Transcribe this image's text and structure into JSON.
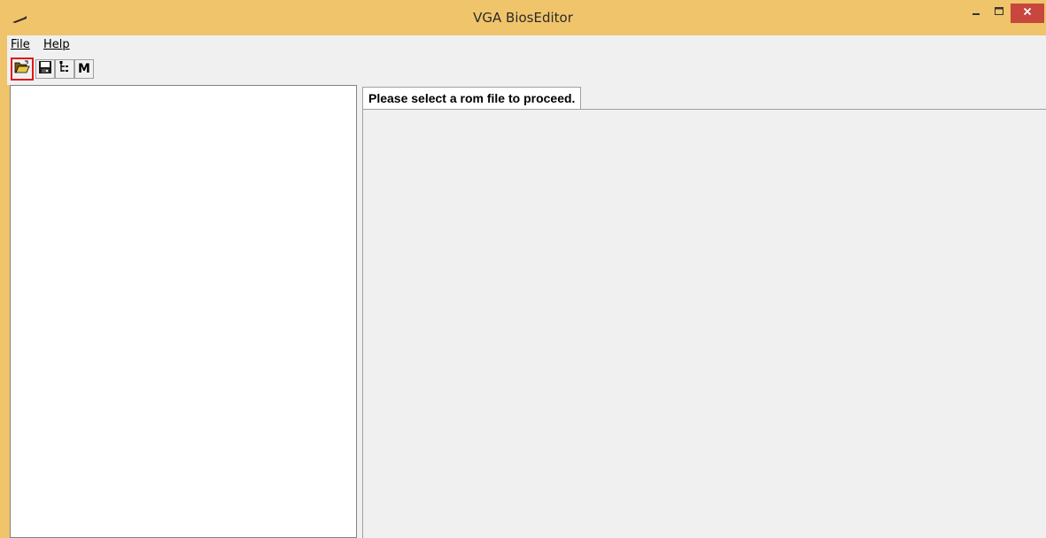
{
  "window": {
    "title": "VGA BiosEditor",
    "accent_color": "#f0c46a",
    "close_color": "#c7463d"
  },
  "titlebar_buttons": {
    "minimize_icon": "minimize-icon",
    "maximize_icon": "maximize-icon",
    "close_icon": "close-icon"
  },
  "menubar": {
    "items": [
      {
        "label": "File",
        "mnemonic": "F"
      },
      {
        "label": "Help",
        "mnemonic": "H"
      }
    ]
  },
  "toolbar": {
    "buttons": [
      {
        "icon": "open-folder-icon",
        "highlighted": true,
        "highlight_color": "#e01818"
      },
      {
        "icon": "save-disk-icon"
      },
      {
        "icon": "tree-view-icon"
      },
      {
        "icon": "m-letter-icon",
        "label": "M"
      }
    ]
  },
  "main": {
    "tab_label": "Please select a rom file to proceed."
  }
}
